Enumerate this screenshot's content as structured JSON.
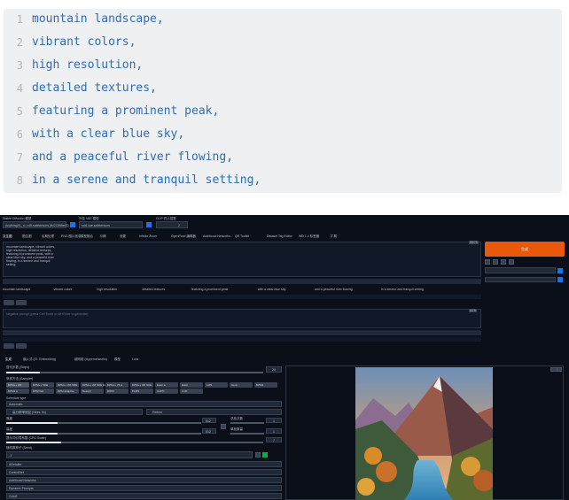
{
  "code": {
    "lines": [
      {
        "num": "1",
        "text": "mountain landscape,"
      },
      {
        "num": "2",
        "text": "vibrant colors,"
      },
      {
        "num": "3",
        "text": "high resolution,"
      },
      {
        "num": "4",
        "text": "detailed textures,"
      },
      {
        "num": "5",
        "text": "featuring a prominent peak,"
      },
      {
        "num": "6",
        "text": "with a clear blue sky,"
      },
      {
        "num": "7",
        "text": "and a peaceful river flowing,"
      },
      {
        "num": "8",
        "text": "in a serene and tranquil setting,"
      }
    ]
  },
  "webui": {
    "checkpoint_label": "Stable Diffusion 模型",
    "checkpoint_value": "AnythingXL_xl_v45.safetensors [8421598e93]",
    "vae_label": "外挂 VAE 模型",
    "vae_value": "sdxl.vae.safetensors",
    "clip_label": "CLIP 终止层数",
    "clip_value": "2",
    "tabs": [
      "文生图",
      "图生图",
      "后期处理",
      "PNG 图片信息",
      "模型融合",
      "训练",
      "设置",
      "Infinite Zoom",
      "OpenPose 编辑器",
      "Additional Networks",
      "QR Toolkit",
      "Dataset Tag Editor",
      "WD 1.4 标签器",
      "扩展"
    ],
    "prompt_text": "mountain landscape, vibrant colors, high resolution, detailed textures, featuring a prominent peak, with a clear blue sky, and a peaceful river flowing, in a serene and tranquil setting,",
    "prompt_counter": "55/75",
    "generate_label": "生成",
    "negative_placeholder": "Negative prompt (press Ctrl+Enter or Alt+Enter to generate)",
    "negative_counter": "0/75",
    "settings_tabs": [
      "生成",
      "嵌入式 (T.I. Embedding)",
      "超网络 (Hypernetworks)",
      "模型",
      "Lora"
    ],
    "sampling_method_label": "采样方法 (Sampler)",
    "sampling_steps_label": "迭代步数 (Steps)",
    "sampling_steps_value": "20",
    "samplers": [
      "DPM++ 2M",
      "DPM++ SDE",
      "DPM++ 2M SDE",
      "DPM++ 2M SDE Heun",
      "DPM++ 2S a",
      "DPM++ 3M SDE",
      "Euler a",
      "Euler",
      "LMS",
      "Heun",
      "DPM2",
      "DPM2 a",
      "DPM fast",
      "DPM adaptive",
      "Restart",
      "DDIM",
      "PLMS",
      "UniPC",
      "LCM"
    ],
    "schedule_label": "Schedule type",
    "schedule_value": "Automatic",
    "hires_label": "高分辨率修复 (Hires. fix)",
    "refiner_label": "Refiner",
    "width_label": "宽度",
    "width_value": "512",
    "height_label": "高度",
    "height_value": "512",
    "batch_count_label": "总批次数",
    "batch_count_value": "1",
    "batch_size_label": "单批数量",
    "batch_size_value": "1",
    "cfg_label": "提示词引导系数 (CFG Scale)",
    "cfg_value": "7",
    "seed_label": "随机数种子 (Seed)",
    "seed_value": "-1",
    "accordions": [
      "ADetailer",
      "ControlNet",
      "Additional Networks",
      "Dynamic Prompts",
      "Cutoff"
    ],
    "colors": {
      "generate": "#ea580c",
      "bg": "#0b0f19",
      "code_text": "#2f6db1"
    }
  }
}
